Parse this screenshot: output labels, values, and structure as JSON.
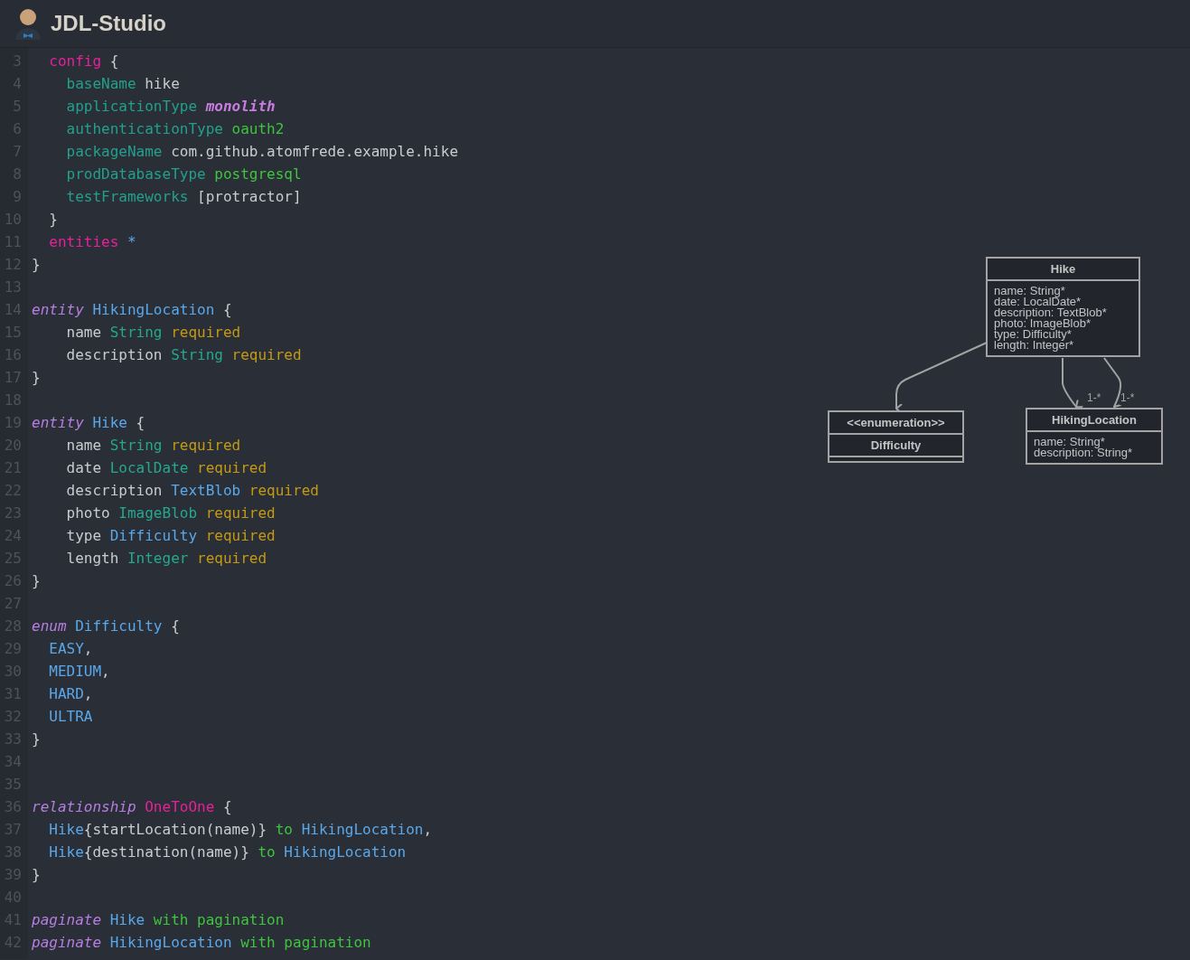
{
  "header": {
    "title": "JDL-Studio"
  },
  "editor": {
    "lines": [
      {
        "number": "3",
        "tokens": [
          {
            "text": "  config",
            "kind": "keyword"
          },
          {
            "text": " {",
            "kind": "plain"
          }
        ]
      },
      {
        "number": "4",
        "tokens": [
          {
            "text": "    baseName",
            "kind": "option"
          },
          {
            "text": " hike",
            "kind": "plain"
          }
        ]
      },
      {
        "number": "5",
        "tokens": [
          {
            "text": "    applicationType ",
            "kind": "option"
          },
          {
            "text": "monolith",
            "kind": "constant"
          }
        ]
      },
      {
        "number": "6",
        "tokens": [
          {
            "text": "    authenticationType",
            "kind": "option"
          },
          {
            "text": " oauth2",
            "kind": "value"
          }
        ]
      },
      {
        "number": "7",
        "tokens": [
          {
            "text": "    packageName",
            "kind": "option"
          },
          {
            "text": " com.github.atomfrede.example.hike",
            "kind": "plain"
          }
        ]
      },
      {
        "number": "8",
        "tokens": [
          {
            "text": "    prodDatabaseType",
            "kind": "option"
          },
          {
            "text": " postgresql",
            "kind": "value"
          }
        ]
      },
      {
        "number": "9",
        "tokens": [
          {
            "text": "    testFrameworks",
            "kind": "option"
          },
          {
            "text": " [protractor]",
            "kind": "plain"
          }
        ]
      },
      {
        "number": "10",
        "tokens": [
          {
            "text": "  }",
            "kind": "plain"
          }
        ]
      },
      {
        "number": "11",
        "tokens": [
          {
            "text": "  entities",
            "kind": "keyword"
          },
          {
            "text": " *",
            "kind": "identifier"
          }
        ]
      },
      {
        "number": "12",
        "tokens": [
          {
            "text": "}",
            "kind": "plain"
          }
        ]
      },
      {
        "number": "13"
      },
      {
        "number": "14",
        "tokens": [
          {
            "text": "entity",
            "kind": "declaration"
          },
          {
            "text": " HikingLocation",
            "kind": "identifier"
          },
          {
            "text": " {",
            "kind": "plain"
          }
        ]
      },
      {
        "number": "15",
        "tokens": [
          {
            "text": "    name",
            "kind": "plain"
          },
          {
            "text": " String",
            "kind": "builtin"
          },
          {
            "text": " required",
            "kind": "required"
          }
        ]
      },
      {
        "number": "16",
        "tokens": [
          {
            "text": "    description",
            "kind": "plain"
          },
          {
            "text": " String",
            "kind": "builtin"
          },
          {
            "text": " required",
            "kind": "required"
          }
        ]
      },
      {
        "number": "17",
        "tokens": [
          {
            "text": "}",
            "kind": "plain"
          }
        ]
      },
      {
        "number": "18"
      },
      {
        "number": "19",
        "tokens": [
          {
            "text": "entity",
            "kind": "declaration"
          },
          {
            "text": " Hike",
            "kind": "identifier"
          },
          {
            "text": " {",
            "kind": "plain"
          }
        ]
      },
      {
        "number": "20",
        "tokens": [
          {
            "text": "    name",
            "kind": "plain"
          },
          {
            "text": " String",
            "kind": "builtin"
          },
          {
            "text": " required",
            "kind": "required"
          }
        ]
      },
      {
        "number": "21",
        "tokens": [
          {
            "text": "    date",
            "kind": "plain"
          },
          {
            "text": " LocalDate",
            "kind": "builtin"
          },
          {
            "text": " required",
            "kind": "required"
          }
        ]
      },
      {
        "number": "22",
        "tokens": [
          {
            "text": "    description",
            "kind": "plain"
          },
          {
            "text": " TextBlob",
            "kind": "identifier"
          },
          {
            "text": " required",
            "kind": "required"
          }
        ]
      },
      {
        "number": "23",
        "tokens": [
          {
            "text": "    photo",
            "kind": "plain"
          },
          {
            "text": " ImageBlob",
            "kind": "builtin"
          },
          {
            "text": " required",
            "kind": "required"
          }
        ]
      },
      {
        "number": "24",
        "tokens": [
          {
            "text": "    type",
            "kind": "plain"
          },
          {
            "text": " Difficulty",
            "kind": "identifier"
          },
          {
            "text": " required",
            "kind": "required"
          }
        ]
      },
      {
        "number": "25",
        "tokens": [
          {
            "text": "    length",
            "kind": "plain"
          },
          {
            "text": " Integer",
            "kind": "builtin"
          },
          {
            "text": " required",
            "kind": "required"
          }
        ]
      },
      {
        "number": "26",
        "tokens": [
          {
            "text": "}",
            "kind": "plain"
          }
        ]
      },
      {
        "number": "27"
      },
      {
        "number": "28",
        "tokens": [
          {
            "text": "enum",
            "kind": "declaration"
          },
          {
            "text": " Difficulty",
            "kind": "identifier"
          },
          {
            "text": " {",
            "kind": "plain"
          }
        ]
      },
      {
        "number": "29",
        "tokens": [
          {
            "text": "  EASY",
            "kind": "identifier"
          },
          {
            "text": ",",
            "kind": "plain"
          }
        ]
      },
      {
        "number": "30",
        "tokens": [
          {
            "text": "  MEDIUM",
            "kind": "identifier"
          },
          {
            "text": ",",
            "kind": "plain"
          }
        ]
      },
      {
        "number": "31",
        "tokens": [
          {
            "text": "  HARD",
            "kind": "identifier"
          },
          {
            "text": ",",
            "kind": "plain"
          }
        ]
      },
      {
        "number": "32",
        "tokens": [
          {
            "text": "  ULTRA",
            "kind": "identifier"
          }
        ]
      },
      {
        "number": "33",
        "tokens": [
          {
            "text": "}",
            "kind": "plain"
          }
        ]
      },
      {
        "number": "34"
      },
      {
        "number": "35"
      },
      {
        "number": "36",
        "tokens": [
          {
            "text": "relationship",
            "kind": "declaration"
          },
          {
            "text": " OneToOne",
            "kind": "keyword"
          },
          {
            "text": " {",
            "kind": "plain"
          }
        ]
      },
      {
        "number": "37",
        "tokens": [
          {
            "text": "  Hike",
            "kind": "identifier"
          },
          {
            "text": "{startLocation(name)}",
            "kind": "plain"
          },
          {
            "text": " to",
            "kind": "value"
          },
          {
            "text": " HikingLocation",
            "kind": "identifier"
          },
          {
            "text": ",",
            "kind": "plain"
          }
        ]
      },
      {
        "number": "38",
        "tokens": [
          {
            "text": "  Hike",
            "kind": "identifier"
          },
          {
            "text": "{destination(name)}",
            "kind": "plain"
          },
          {
            "text": " to",
            "kind": "value"
          },
          {
            "text": " HikingLocation",
            "kind": "identifier"
          }
        ]
      },
      {
        "number": "39",
        "tokens": [
          {
            "text": "}",
            "kind": "plain"
          }
        ]
      },
      {
        "number": "40"
      },
      {
        "number": "41",
        "tokens": [
          {
            "text": "paginate",
            "kind": "declaration"
          },
          {
            "text": " Hike",
            "kind": "identifier"
          },
          {
            "text": " with pagination",
            "kind": "value"
          }
        ]
      },
      {
        "number": "42",
        "tokens": [
          {
            "text": "paginate",
            "kind": "declaration"
          },
          {
            "text": " HikingLocation",
            "kind": "identifier"
          },
          {
            "text": " with pagination",
            "kind": "value"
          }
        ]
      }
    ]
  },
  "diagram": {
    "entities": [
      {
        "name": "Hike",
        "fields": [
          "name: String*",
          "date: LocalDate*",
          "description: TextBlob*",
          "photo: ImageBlob*",
          "type: Difficulty*",
          "length: Integer*"
        ]
      },
      {
        "stereotype": "<<enumeration>>",
        "name": "Difficulty"
      },
      {
        "name": "HikingLocation",
        "fields": [
          "name: String*",
          "description: String*"
        ]
      }
    ],
    "relationships": [
      {
        "kind": "reference"
      },
      {
        "kind": "association",
        "label": "1-*"
      },
      {
        "kind": "association",
        "label": "1-*"
      }
    ]
  }
}
